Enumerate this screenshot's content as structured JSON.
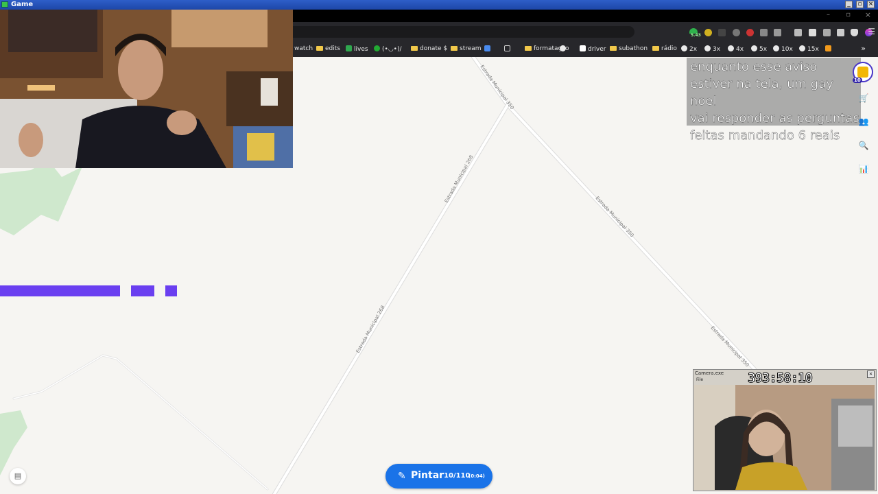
{
  "window": {
    "title": "Game"
  },
  "bookmarks": [
    {
      "label": "watch",
      "icon": "none"
    },
    {
      "label": "edits",
      "icon": "folder"
    },
    {
      "label": "lives",
      "icon": "green-plus"
    },
    {
      "label": "(•◡•)/",
      "icon": "green-leaf"
    },
    {
      "label": "donate $",
      "icon": "folder"
    },
    {
      "label": "stream",
      "icon": "folder"
    },
    {
      "label": "",
      "icon": "blue-square"
    },
    {
      "label": "",
      "icon": "outline-square"
    },
    {
      "label": "formatação",
      "icon": "folder"
    },
    {
      "label": "",
      "icon": "globe"
    },
    {
      "label": "driver",
      "icon": "white-page"
    },
    {
      "label": "subathon",
      "icon": "folder"
    },
    {
      "label": "rádio",
      "icon": "folder"
    },
    {
      "label": "2x",
      "icon": "globe"
    },
    {
      "label": "3x",
      "icon": "globe"
    },
    {
      "label": "4x",
      "icon": "globe"
    },
    {
      "label": "5x",
      "icon": "globe"
    },
    {
      "label": "10x",
      "icon": "globe"
    },
    {
      "label": "15x",
      "icon": "globe"
    }
  ],
  "toolbar": {
    "badge_value": "5.43",
    "overflow_label": "»"
  },
  "map": {
    "roads": [
      {
        "label": "Estrada Municipal 350"
      },
      {
        "label": "Estrada Municipal 268"
      },
      {
        "label": "Estrada Municipal 268"
      },
      {
        "label": "Estrada Municipal 350"
      },
      {
        "label": "Estrada Municipal 350"
      }
    ],
    "colors": {
      "background": "#f6f5f2",
      "road": "#ffffff",
      "road_edge": "#dcdcdc",
      "park": "#cfe8cd",
      "paint": "#6a3ff0"
    }
  },
  "notice": {
    "lines": [
      "enquanto esse aviso",
      "estiver na tela, um gay noel",
      "vai responder as perguntas",
      "feitas mandando 6 reais"
    ]
  },
  "logo": {
    "count": "10"
  },
  "paint_button": {
    "label": "Pintar",
    "count": "10/110",
    "time": "(0:04)",
    "color": "#1a73e8"
  },
  "camera_window": {
    "caption": "Camera.exe",
    "menu": "File",
    "timer": "393:58:10"
  }
}
